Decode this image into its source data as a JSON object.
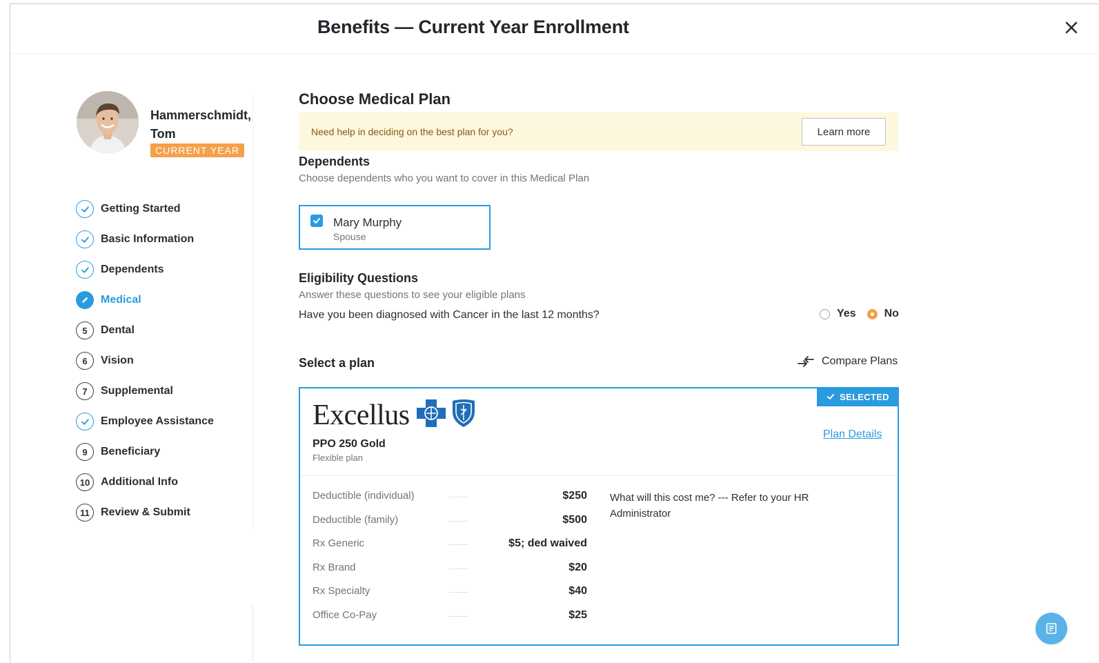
{
  "header": {
    "title": "Benefits — Current Year Enrollment"
  },
  "profile": {
    "name": "Hammerschmidt, Tom",
    "badge": "CURRENT YEAR"
  },
  "steps": [
    {
      "label": "Getting Started",
      "status": "done",
      "number": ""
    },
    {
      "label": "Basic Information",
      "status": "done",
      "number": ""
    },
    {
      "label": "Dependents",
      "status": "done",
      "number": ""
    },
    {
      "label": "Medical",
      "status": "active",
      "number": ""
    },
    {
      "label": "Dental",
      "status": "pending",
      "number": "5"
    },
    {
      "label": "Vision",
      "status": "pending",
      "number": "6"
    },
    {
      "label": "Supplemental",
      "status": "pending",
      "number": "7"
    },
    {
      "label": "Employee Assistance",
      "status": "done",
      "number": ""
    },
    {
      "label": "Beneficiary",
      "status": "pending",
      "number": "9"
    },
    {
      "label": "Additional Info",
      "status": "pending",
      "number": "10"
    },
    {
      "label": "Review & Submit",
      "status": "pending",
      "number": "11"
    }
  ],
  "main": {
    "heading": "Choose Medical Plan",
    "help": {
      "text": "Need help in deciding on the best plan for you?",
      "button": "Learn more"
    },
    "dependents": {
      "heading": "Dependents",
      "description": "Choose dependents who you want to cover in this Medical Plan",
      "items": [
        {
          "name": "Mary Murphy",
          "relation": "Spouse",
          "checked": true
        }
      ]
    },
    "eligibility": {
      "heading": "Eligibility Questions",
      "description": "Answer these questions to see your eligible plans",
      "question": "Have you been diagnosed with Cancer in the last 12 months?",
      "options": [
        "Yes",
        "No"
      ],
      "selected": "No"
    },
    "select_plan": {
      "heading": "Select a plan",
      "compare_label": "Compare Plans"
    },
    "plan": {
      "badge": "SELECTED",
      "brand": "Excellus",
      "name": "PPO 250 Gold",
      "type": "Flexible plan",
      "details_link": "Plan Details",
      "costs": [
        {
          "label": "Deductible (individual)",
          "value": "$250"
        },
        {
          "label": "Deductible (family)",
          "value": "$500"
        },
        {
          "label": "Rx Generic",
          "value": "$5; ded waived"
        },
        {
          "label": "Rx Brand",
          "value": "$20"
        },
        {
          "label": "Rx Specialty",
          "value": "$40"
        },
        {
          "label": "Office Co-Pay",
          "value": "$25"
        }
      ],
      "cost_note": "What will this cost me? --- Refer to your HR Administrator"
    }
  },
  "colors": {
    "accent": "#2b9be0",
    "badge": "#f5a04a",
    "banner": "#fdf7dd"
  }
}
